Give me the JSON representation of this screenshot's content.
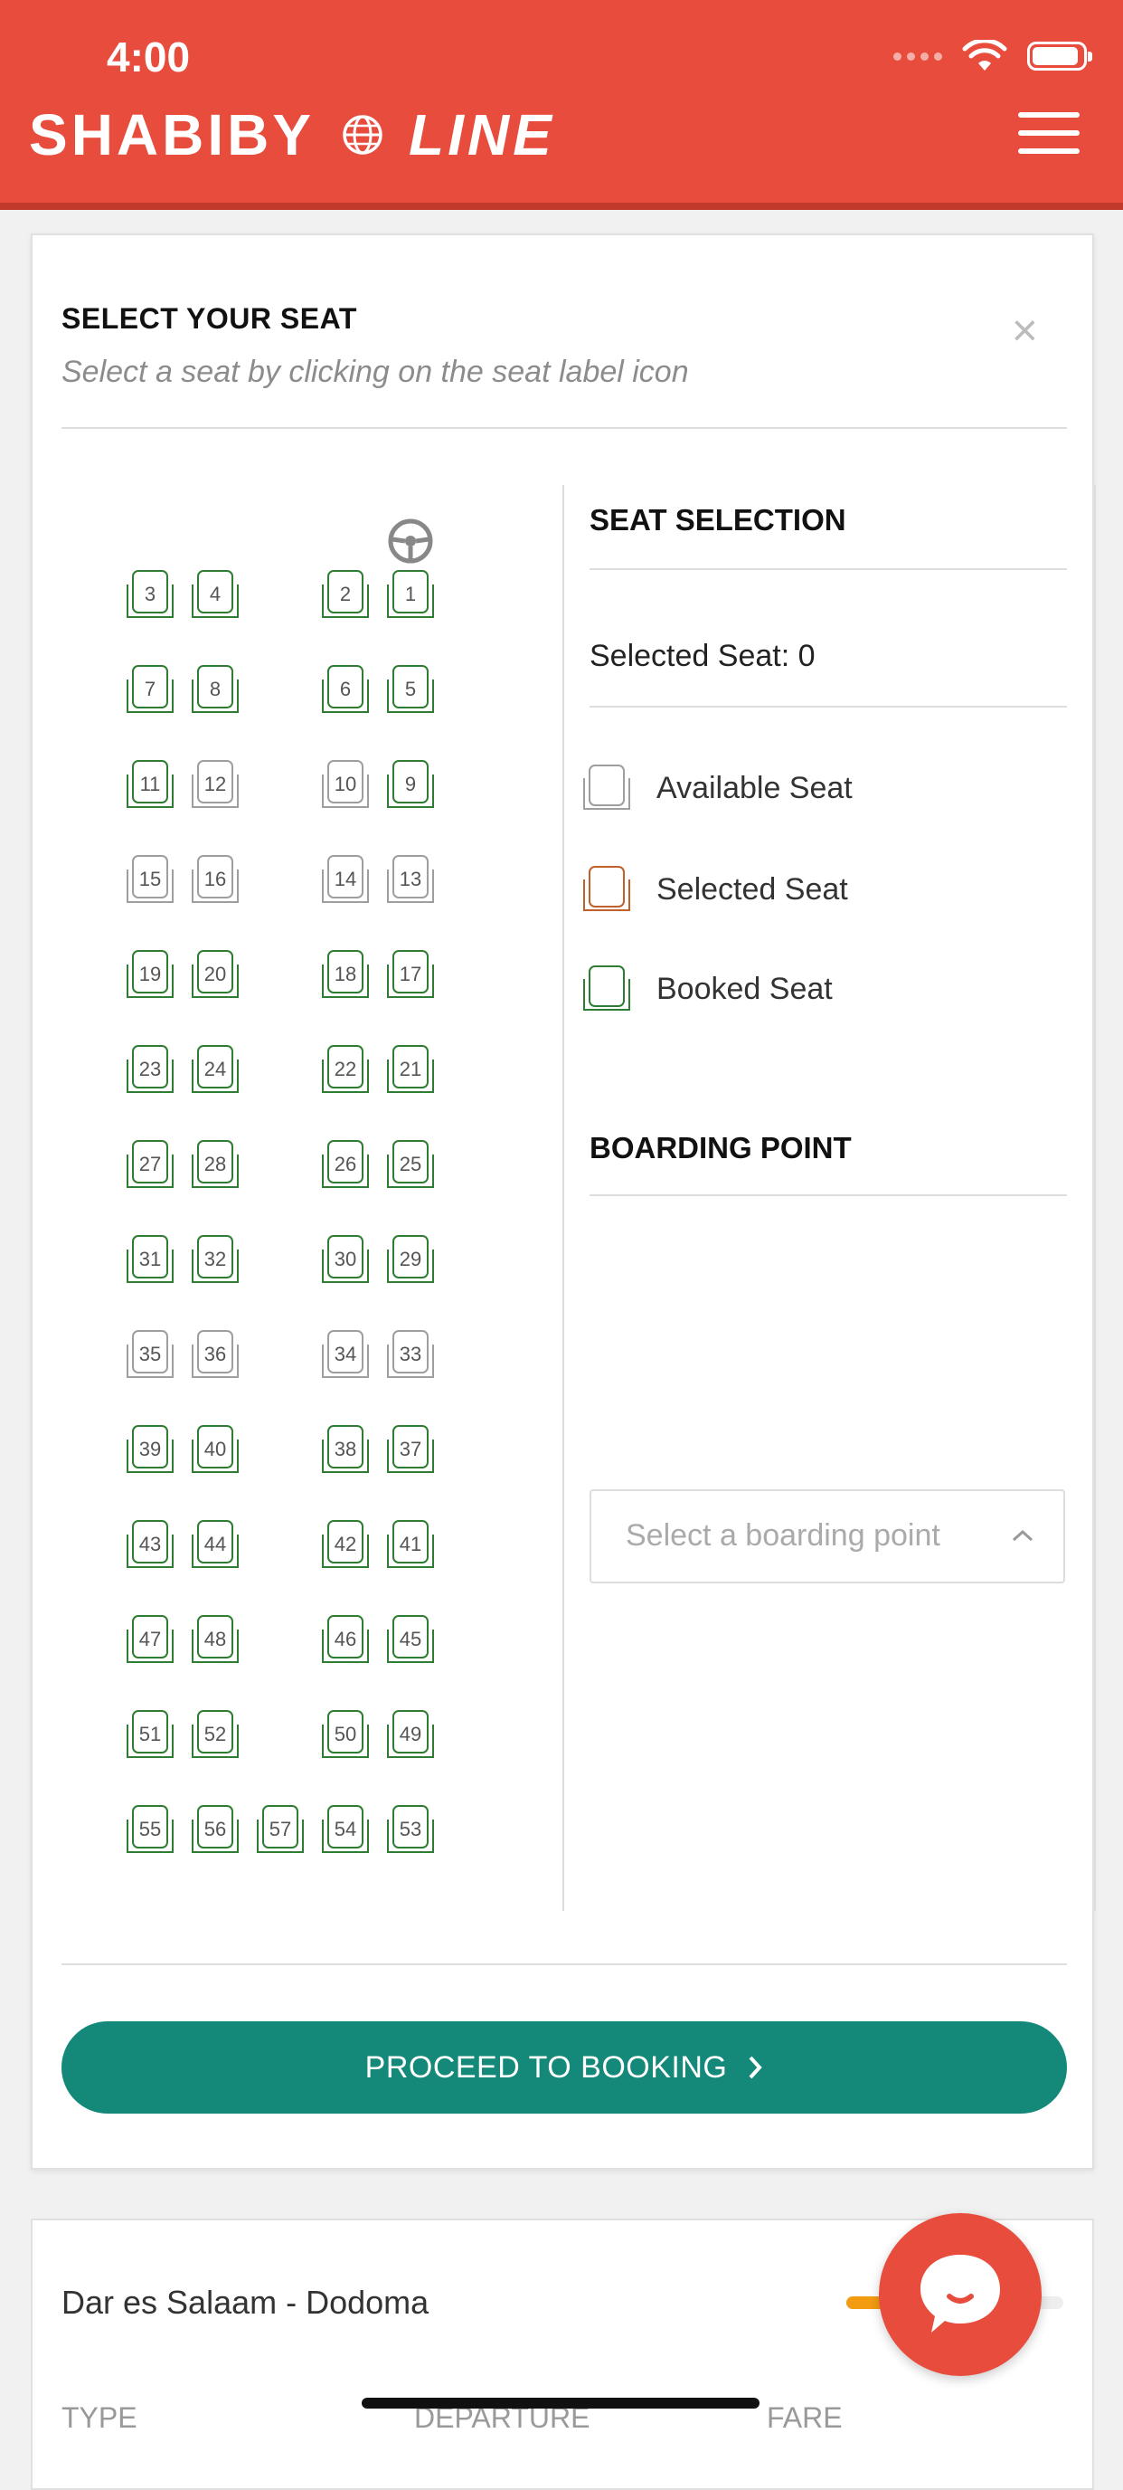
{
  "status": {
    "time": "4:00"
  },
  "header": {
    "brand_left": "SHABIBY",
    "brand_right": "LINE"
  },
  "seat_select": {
    "title": "SELECT YOUR SEAT",
    "subtitle": "Select a seat by clicking on the seat label icon",
    "seats": [
      {
        "n": "3",
        "state": "booked"
      },
      {
        "n": "4",
        "state": "booked"
      },
      {
        "n": "2",
        "state": "booked"
      },
      {
        "n": "1",
        "state": "booked"
      },
      {
        "n": "7",
        "state": "booked"
      },
      {
        "n": "8",
        "state": "booked"
      },
      {
        "n": "6",
        "state": "booked"
      },
      {
        "n": "5",
        "state": "booked"
      },
      {
        "n": "11",
        "state": "booked"
      },
      {
        "n": "12",
        "state": "available"
      },
      {
        "n": "10",
        "state": "available"
      },
      {
        "n": "9",
        "state": "booked"
      },
      {
        "n": "15",
        "state": "available"
      },
      {
        "n": "16",
        "state": "available"
      },
      {
        "n": "14",
        "state": "available"
      },
      {
        "n": "13",
        "state": "available"
      },
      {
        "n": "19",
        "state": "booked"
      },
      {
        "n": "20",
        "state": "booked"
      },
      {
        "n": "18",
        "state": "booked"
      },
      {
        "n": "17",
        "state": "booked"
      },
      {
        "n": "23",
        "state": "booked"
      },
      {
        "n": "24",
        "state": "booked"
      },
      {
        "n": "22",
        "state": "booked"
      },
      {
        "n": "21",
        "state": "booked"
      },
      {
        "n": "27",
        "state": "booked"
      },
      {
        "n": "28",
        "state": "booked"
      },
      {
        "n": "26",
        "state": "booked"
      },
      {
        "n": "25",
        "state": "booked"
      },
      {
        "n": "31",
        "state": "booked"
      },
      {
        "n": "32",
        "state": "booked"
      },
      {
        "n": "30",
        "state": "booked"
      },
      {
        "n": "29",
        "state": "booked"
      },
      {
        "n": "35",
        "state": "available"
      },
      {
        "n": "36",
        "state": "available"
      },
      {
        "n": "34",
        "state": "available"
      },
      {
        "n": "33",
        "state": "available"
      },
      {
        "n": "39",
        "state": "booked"
      },
      {
        "n": "40",
        "state": "booked"
      },
      {
        "n": "38",
        "state": "booked"
      },
      {
        "n": "37",
        "state": "booked"
      },
      {
        "n": "43",
        "state": "booked"
      },
      {
        "n": "44",
        "state": "booked"
      },
      {
        "n": "42",
        "state": "booked"
      },
      {
        "n": "41",
        "state": "booked"
      },
      {
        "n": "47",
        "state": "booked"
      },
      {
        "n": "48",
        "state": "booked"
      },
      {
        "n": "46",
        "state": "booked"
      },
      {
        "n": "45",
        "state": "booked"
      },
      {
        "n": "51",
        "state": "booked"
      },
      {
        "n": "52",
        "state": "booked"
      },
      {
        "n": "50",
        "state": "booked"
      },
      {
        "n": "49",
        "state": "booked"
      },
      {
        "n": "55",
        "state": "booked"
      },
      {
        "n": "56",
        "state": "booked"
      },
      {
        "n": "57",
        "state": "booked"
      },
      {
        "n": "54",
        "state": "booked"
      },
      {
        "n": "53",
        "state": "booked"
      }
    ]
  },
  "panel": {
    "seat_selection_title": "SEAT SELECTION",
    "selected_seat": "Selected Seat: 0",
    "legend_available": "Available Seat",
    "legend_selected": "Selected Seat",
    "legend_booked": "Booked Seat",
    "boarding_title": "BOARDING POINT",
    "boarding_placeholder": "Select a boarding point"
  },
  "proceed_label": "PROCEED TO BOOKING",
  "trip": {
    "route": "Dar es Salaam - Dodoma",
    "progress": 0.35,
    "col_type": "TYPE",
    "col_departure": "DEPARTURE",
    "col_fare": "FARE"
  },
  "colors": {
    "brand_red": "#e84c3d",
    "booked": "#2e7d32",
    "available": "#9e9e9e",
    "selected": "#c0602a",
    "proceed": "#14897a"
  },
  "icons": [
    "wifi-icon",
    "battery-icon",
    "globe-icon",
    "menu-icon",
    "close-icon",
    "steering-wheel-icon",
    "seat-icon",
    "chevron-up-icon",
    "chevron-right-icon",
    "chat-icon"
  ]
}
